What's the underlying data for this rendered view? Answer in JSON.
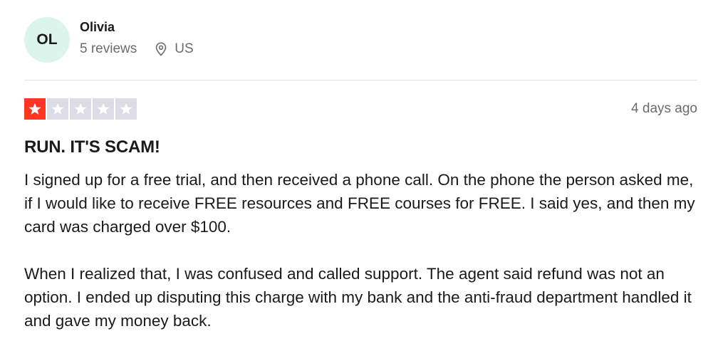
{
  "consumer": {
    "initials": "OL",
    "name": "Olivia",
    "review_count": "5 reviews",
    "location": "US",
    "location_icon": "location-pin-icon",
    "avatar_color": "#dcf5ec"
  },
  "rating": {
    "stars": 1,
    "max_stars": 5,
    "filled_color": "#ff3722",
    "empty_color": "#dcdce6"
  },
  "review": {
    "date": "4 days ago",
    "title": "RUN. IT'S SCAM!",
    "paragraphs": [
      "I signed up for a free trial, and then received a phone call. On the phone the person asked me, if I would like to receive FREE resources and FREE courses for FREE. I said yes, and then my card was charged over $100.",
      "When I realized that, I was confused and called support. The agent said refund was not an option. I ended up disputing this charge with my bank and the anti-fraud department handled it and gave my money back."
    ]
  }
}
